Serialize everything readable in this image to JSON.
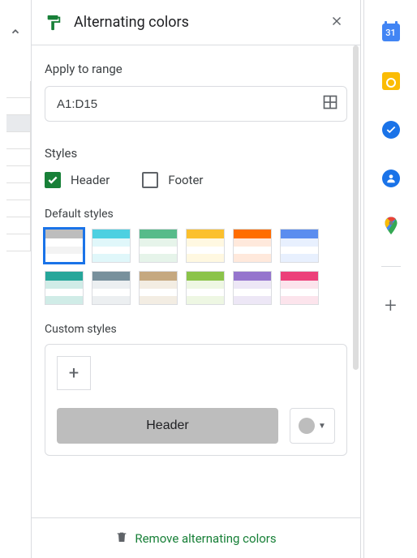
{
  "panel": {
    "title": "Alternating colors",
    "apply_label": "Apply to range",
    "range_value": "A1:D15",
    "styles_label": "Styles",
    "header_check_label": "Header",
    "header_checked": true,
    "footer_check_label": "Footer",
    "footer_checked": false,
    "default_styles_label": "Default styles",
    "custom_styles_label": "Custom styles",
    "custom_header_btn": "Header",
    "remove_label": "Remove alternating colors"
  },
  "default_swatches": [
    {
      "head": "#bdbdbd",
      "r1": "#ffffff",
      "r2": "#f3f3f3",
      "selected": true
    },
    {
      "head": "#4dd0e1",
      "r1": "#e0f7fa",
      "r2": "#ffffff",
      "selected": false
    },
    {
      "head": "#57bb8a",
      "r1": "#e6f4ea",
      "r2": "#ffffff",
      "selected": false
    },
    {
      "head": "#fbc02d",
      "r1": "#fff8e1",
      "r2": "#ffffff",
      "selected": false
    },
    {
      "head": "#ff6d00",
      "r1": "#ffe9dc",
      "r2": "#ffffff",
      "selected": false
    },
    {
      "head": "#5b8def",
      "r1": "#e8f0fe",
      "r2": "#ffffff",
      "selected": false
    },
    {
      "head": "#26a69a",
      "r1": "#d0ece7",
      "r2": "#ffffff",
      "selected": false
    },
    {
      "head": "#78909c",
      "r1": "#eceff1",
      "r2": "#ffffff",
      "selected": false
    },
    {
      "head": "#c5a880",
      "r1": "#f3ede3",
      "r2": "#ffffff",
      "selected": false
    },
    {
      "head": "#8bc34a",
      "r1": "#eef7e3",
      "r2": "#ffffff",
      "selected": false
    },
    {
      "head": "#9575cd",
      "r1": "#ede7f6",
      "r2": "#ffffff",
      "selected": false
    },
    {
      "head": "#ec407a",
      "r1": "#fce4ec",
      "r2": "#ffffff",
      "selected": false
    }
  ],
  "rail": {
    "calendar_day": "31"
  }
}
